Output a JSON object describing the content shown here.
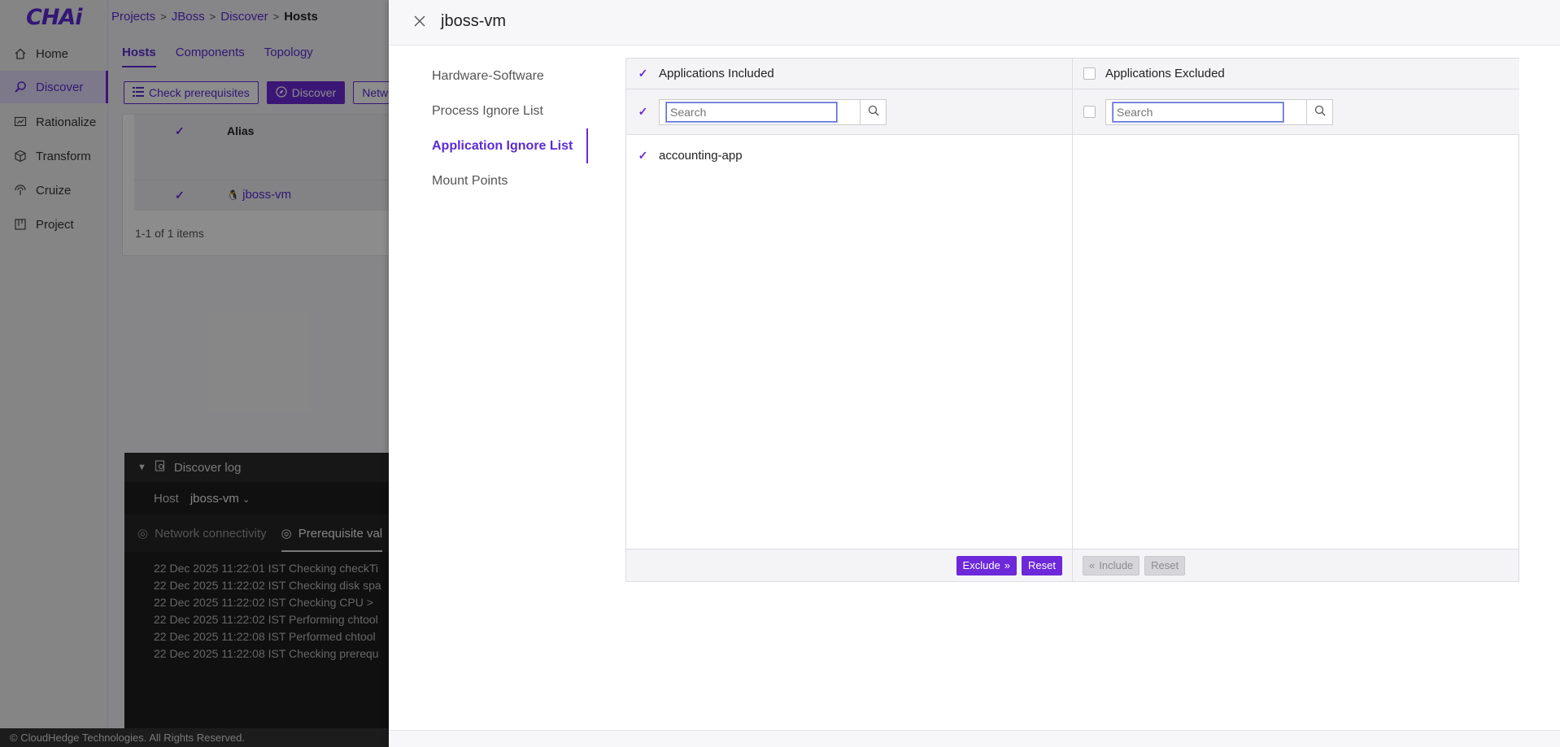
{
  "app": {
    "logo": "CHAi",
    "nav": [
      {
        "label": "Home",
        "icon": "home-icon"
      },
      {
        "label": "Discover",
        "icon": "discover-icon"
      },
      {
        "label": "Rationalize",
        "icon": "rationalize-icon"
      },
      {
        "label": "Transform",
        "icon": "transform-icon"
      },
      {
        "label": "Cruize",
        "icon": "cruize-icon"
      },
      {
        "label": "Project",
        "icon": "project-icon"
      }
    ],
    "breadcrumb": [
      "Projects",
      "JBoss",
      "Discover",
      "Hosts"
    ],
    "tabs": [
      "Hosts",
      "Components",
      "Topology"
    ],
    "toolbar": {
      "check_prereq": "Check prerequisites",
      "discover": "Discover",
      "network": "Netw"
    },
    "table": {
      "column_alias": "Alias",
      "row_alias": "jboss-vm",
      "pager": "1-1 of 1 items"
    },
    "log": {
      "title": "Discover log",
      "host_label": "Host",
      "host_value": "jboss-vm",
      "tab_network": "Network connectivity",
      "tab_prereq": "Prerequisite val",
      "lines": [
        "22 Dec 2025 11:22:01 IST Checking checkTi",
        "22 Dec 2025 11:22:02 IST Checking disk spa",
        "22 Dec 2025 11:22:02 IST Checking CPU > ",
        "22 Dec 2025 11:22:02 IST Performing chtool",
        "22 Dec 2025 11:22:08 IST Performed chtool",
        "22 Dec 2025 11:22:08 IST Checking prerequ"
      ]
    },
    "footer": "© CloudHedge Technologies. All Rights Reserved."
  },
  "drawer": {
    "title": "jboss-vm",
    "nav": [
      {
        "label": "Hardware-Software",
        "active": false
      },
      {
        "label": "Process Ignore List",
        "active": false
      },
      {
        "label": "Application Ignore List",
        "active": true
      },
      {
        "label": "Mount Points",
        "active": false
      }
    ],
    "included": {
      "title": "Applications Included",
      "search_placeholder": "Search",
      "items": [
        "accounting-app"
      ],
      "exclude_label": "Exclude",
      "reset_label": "Reset"
    },
    "excluded": {
      "title": "Applications Excluded",
      "search_placeholder": "Search",
      "items": [],
      "include_label": "Include",
      "reset_label": "Reset"
    }
  },
  "colors": {
    "accent": "#6d28d9",
    "accent_text": "#5b2bd6"
  }
}
